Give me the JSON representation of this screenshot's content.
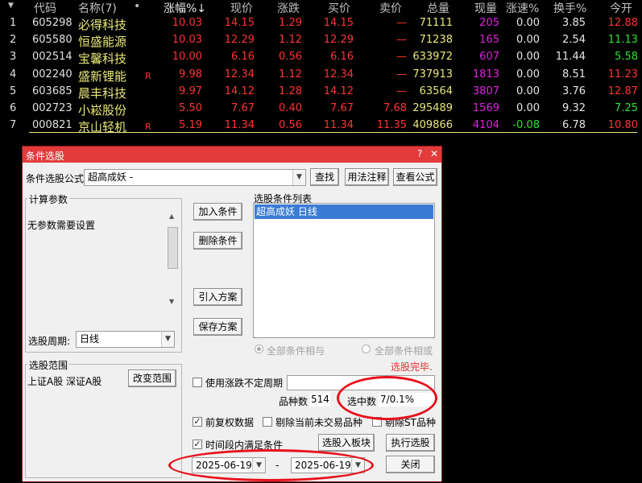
{
  "quote_table": {
    "columns": [
      "代码",
      "名称(7)",
      "•",
      "涨幅%↓",
      "现价",
      "涨跌",
      "买价",
      "卖价",
      "总量",
      "现量",
      "涨速%",
      "换手%",
      "今开"
    ],
    "rows": [
      {
        "idx": "1",
        "code": "605298",
        "name": "必得科技",
        "flag": "",
        "change_pct": "10.03",
        "price": "14.15",
        "change": "1.29",
        "bid": "14.15",
        "ask": "—",
        "volume": "71111",
        "cur_vol": "205",
        "speed": "0.00",
        "turnover": "3.85",
        "open": "12.88"
      },
      {
        "idx": "2",
        "code": "605580",
        "name": "恒盛能源",
        "flag": "",
        "change_pct": "10.03",
        "price": "12.29",
        "change": "1.12",
        "bid": "12.29",
        "ask": "—",
        "volume": "71238",
        "cur_vol": "165",
        "speed": "0.00",
        "turnover": "2.54",
        "open": "11.13"
      },
      {
        "idx": "3",
        "code": "002514",
        "name": "宝馨科技",
        "flag": "",
        "change_pct": "10.00",
        "price": "6.16",
        "change": "0.56",
        "bid": "6.16",
        "ask": "—",
        "volume": "633972",
        "cur_vol": "607",
        "speed": "0.00",
        "turnover": "11.44",
        "open": "5.58"
      },
      {
        "idx": "4",
        "code": "002240",
        "name": "盛新锂能",
        "flag": "R",
        "change_pct": "9.98",
        "price": "12.34",
        "change": "1.12",
        "bid": "12.34",
        "ask": "—",
        "volume": "737913",
        "cur_vol": "1813",
        "speed": "0.00",
        "turnover": "8.51",
        "open": "11.23"
      },
      {
        "idx": "5",
        "code": "603685",
        "name": "晨丰科技",
        "flag": "",
        "change_pct": "9.97",
        "price": "14.12",
        "change": "1.28",
        "bid": "14.12",
        "ask": "—",
        "volume": "63564",
        "cur_vol": "3807",
        "speed": "0.00",
        "turnover": "3.76",
        "open": "12.87"
      },
      {
        "idx": "6",
        "code": "002723",
        "name": "小崧股份",
        "flag": "",
        "change_pct": "5.50",
        "price": "7.67",
        "change": "0.40",
        "bid": "7.67",
        "ask": "7.68",
        "volume": "295489",
        "cur_vol": "1569",
        "speed": "0.00",
        "turnover": "9.32",
        "open": "7.25"
      },
      {
        "idx": "7",
        "code": "000821",
        "name": "京山轻机",
        "flag": "R",
        "change_pct": "5.19",
        "price": "11.34",
        "change": "0.56",
        "bid": "11.34",
        "ask": "11.35",
        "volume": "409866",
        "cur_vol": "4104",
        "speed": "-0.08",
        "turnover": "6.78",
        "open": "10.80"
      }
    ]
  },
  "dialog": {
    "title": "条件选股",
    "help_glyph": "?",
    "close_glyph": "✕",
    "formula_label": "条件选股公式",
    "formula_value": "超高成妖  -",
    "find_button": "查找",
    "usage_button": "用法注释",
    "view_formula_button": "查看公式",
    "params_group": "计算参数",
    "params_text": "无参数需要设置",
    "add_condition": "加入条件",
    "delete_condition": "删除条件",
    "import_plan": "引入方案",
    "save_plan": "保存方案",
    "condition_list_label": "选股条件列表",
    "condition_items": [
      "超高成妖  日线"
    ],
    "period_label": "选股周期:",
    "period_value": "日线",
    "radio_and": "全部条件相与",
    "radio_or": "全部条件相或",
    "status_text": "选股完毕.",
    "range_group": "选股范围",
    "range_text": "上证A股 深证A股",
    "change_range": "改变范围",
    "use_uncertain_period": "使用涨跌不定周期",
    "count_label": "品种数",
    "count_value": "514",
    "selected_label": "选中数",
    "selected_value": "7/0.1%",
    "pre_adjust": "前复权数据",
    "exclude_untraded": "剔除当前未交易品种",
    "exclude_st": "剔除ST品种",
    "time_range_check": "时间段内满足条件",
    "to_block_button": "选股入板块",
    "execute_button": "执行选股",
    "date_start": "2025-06-19",
    "date_sep": "-",
    "date_end": "2025-06-19",
    "close_button": "关闭"
  },
  "colors": {
    "highlight_oval": "#e8101c",
    "title_bar": "#e33b3b",
    "selection": "#3a7bd5"
  }
}
